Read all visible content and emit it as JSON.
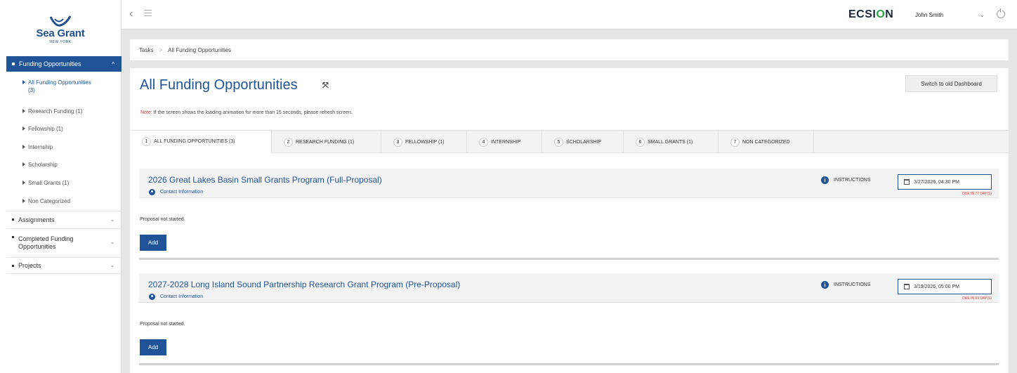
{
  "brand": {
    "name": "Sea Grant",
    "sub": "NEW YORK"
  },
  "topbar": {
    "product": "ECSI",
    "product_o": "O",
    "product_end": "N",
    "user": "John Smith",
    "caret": "⌄",
    "back_icon": "‹"
  },
  "sidebar": {
    "active_section": "Funding Opportunities",
    "active_caret": "^",
    "subitems": [
      {
        "label_1": "All Funding Opportunities",
        "label_2": "(3)"
      },
      {
        "label": "Research Funding (1)"
      },
      {
        "label": "Fellowship (1)"
      },
      {
        "label": "Internship"
      },
      {
        "label": "Scholarship"
      },
      {
        "label": "Small Grants (1)"
      },
      {
        "label": "Non Categorized"
      }
    ],
    "sections": [
      {
        "label": "Assignments"
      },
      {
        "label_1": "Completed Funding",
        "label_2": "Opportunities"
      },
      {
        "label": "Projects"
      }
    ],
    "chev": "⌄"
  },
  "breadcrumb": {
    "root": "Tasks",
    "sep": ">",
    "current": "All Funding Opportunities"
  },
  "main": {
    "title": "All Funding Opportunities",
    "expand_icon": "⤧",
    "switch_label": "Switch to old Dashboard",
    "note_label": "Note:",
    "note_text": " If the screen shows the loading animation for more than 15 seconds, please refresh screen.",
    "tabs": [
      {
        "num": "1",
        "label": "ALL FUNDING OPPORTUNITIES (3)"
      },
      {
        "num": "2",
        "label": "RESEARCH FUNDING (1)"
      },
      {
        "num": "3",
        "label": "FELLOWSHIP (1)"
      },
      {
        "num": "4",
        "label": "INTERNSHIP"
      },
      {
        "num": "5",
        "label": "SCHOLARSHIP"
      },
      {
        "num": "6",
        "label": "SMALL GRANTS (1)"
      },
      {
        "num": "7",
        "label": "NON CATEGORIZED"
      }
    ],
    "cards": [
      {
        "title": "2026 Great Lakes Basin Small Grants Program (Full-Proposal)",
        "contact": "Contact Information",
        "instructions": "INSTRUCTIONS",
        "date": "3/27/2026, 04:30 PM",
        "due": "DUE IN 77 DAY(S)",
        "status": "Proposal not started.",
        "add": "Add"
      },
      {
        "title": "2027-2028 Long Island Sound Partnership Research Grant Program (Pre-Proposal)",
        "contact": "Contact Information",
        "instructions": "INSTRUCTIONS",
        "date": "3/19/2026, 05:00 PM",
        "due": "DUE IN 69 DAY(S)",
        "status": "Proposal not started.",
        "add": "Add"
      }
    ]
  }
}
